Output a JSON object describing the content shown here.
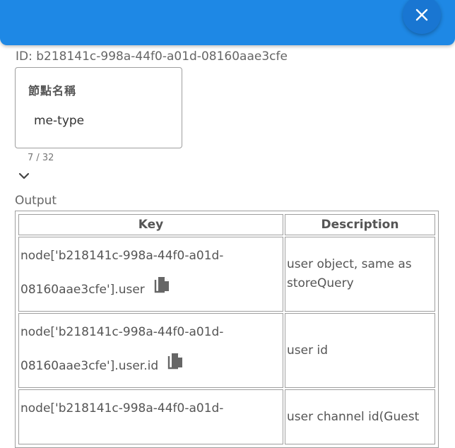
{
  "header": {
    "color": "#1e88e5",
    "close_icon": "close-icon"
  },
  "node_id_line": "ID: b218141c-998a-44f0-a01d-08160aae3cfe",
  "name_field": {
    "label": "節點名稱",
    "value": "me-type",
    "counter": "7 / 32"
  },
  "expand_icon": "chevron-down-icon",
  "output": {
    "label": "Output",
    "columns": [
      "Key",
      "Description"
    ],
    "rows": [
      {
        "key_line1": "node['b218141c-998a-44f0-a01d-",
        "key_line2": "08160aae3cfe'].user",
        "description": "user object, same as storeQuery"
      },
      {
        "key_line1": "node['b218141c-998a-44f0-a01d-",
        "key_line2": "08160aae3cfe'].user.id",
        "description": "user id"
      },
      {
        "key_line1": "node['b218141c-998a-44f0-a01d-",
        "key_line2": "",
        "description": "user channel id(Guest"
      }
    ]
  }
}
